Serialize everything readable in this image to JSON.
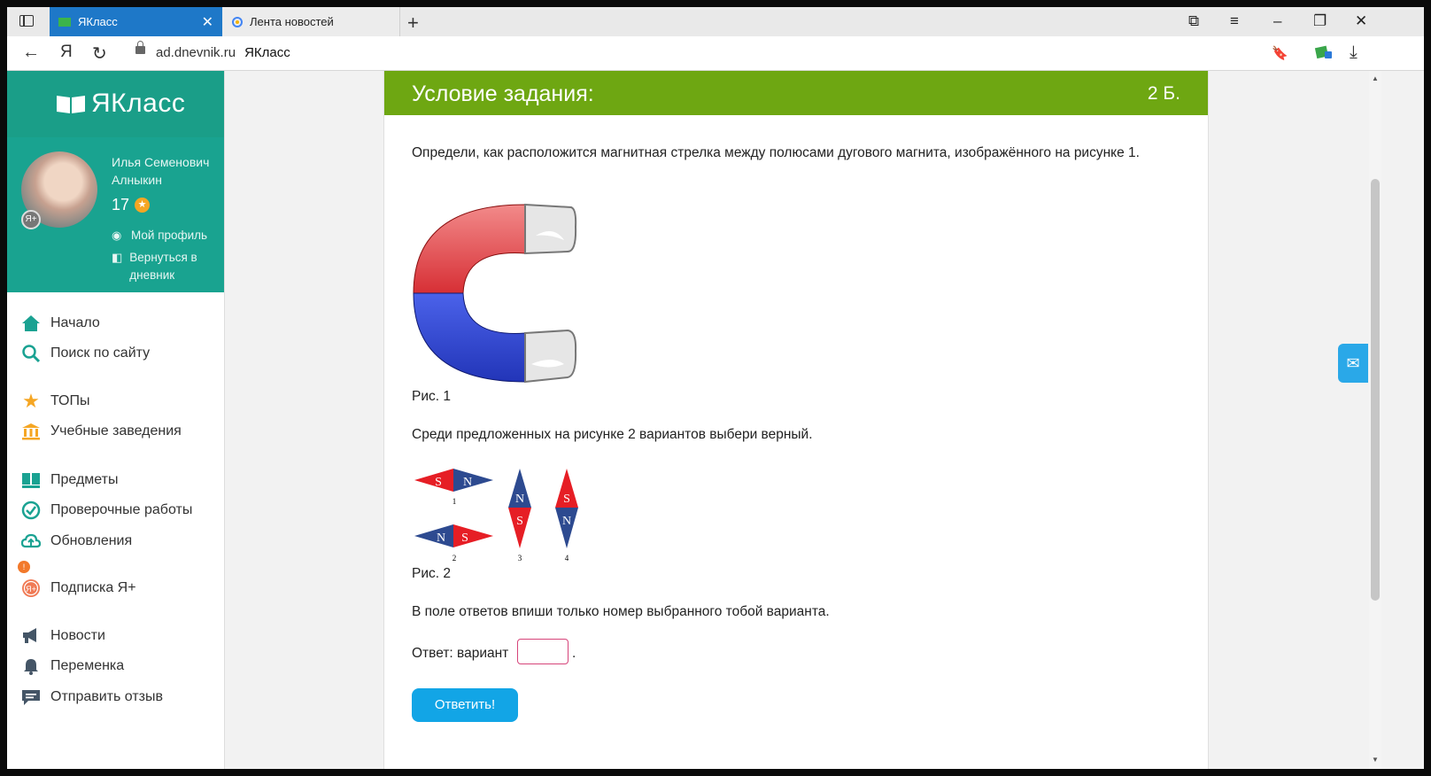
{
  "browser": {
    "tabs": [
      {
        "label": "ЯКласс",
        "active": true
      },
      {
        "label": "Лента новостей",
        "active": false
      }
    ],
    "url_host": "ad.dnevnik.ru",
    "url_title": "ЯКласс"
  },
  "sidebar": {
    "logo": "ЯКласс",
    "profile": {
      "name": "Илья Семенович Алныкин",
      "score": "17",
      "links": [
        {
          "label": "Мой профиль"
        },
        {
          "label": "Вернуться в дневник"
        }
      ]
    },
    "menu": [
      {
        "label": "Начало"
      },
      {
        "label": "Поиск по сайту"
      },
      {
        "label": "ТОПы"
      },
      {
        "label": "Учебные заведения"
      },
      {
        "label": "Предметы"
      },
      {
        "label": "Проверочные работы",
        "badge": "!"
      },
      {
        "label": "Обновления"
      },
      {
        "label": "Подписка Я+"
      },
      {
        "label": "Новости"
      },
      {
        "label": "Переменка"
      },
      {
        "label": "Отправить отзыв"
      }
    ]
  },
  "task": {
    "title": "Условие задания:",
    "points": "2 Б.",
    "question": "Определи, как расположится магнитная стрелка между полюсами дугового магнита, изображённого на рисунке 1.",
    "fig1_caption": "Рис. 1",
    "instruction": "Среди предложенных на рисунке 2 вариантов выбери верный.",
    "fig2_caption": "Рис. 2",
    "fig2_options": [
      {
        "number": "1",
        "poles": [
          "S",
          "N"
        ]
      },
      {
        "number": "2",
        "poles": [
          "N",
          "S"
        ]
      },
      {
        "number": "3",
        "poles": [
          "N",
          "S"
        ]
      },
      {
        "number": "4",
        "poles": [
          "S",
          "N"
        ]
      }
    ],
    "answer_hint": "В поле ответов впиши только номер выбранного тобой варианта.",
    "answer_label": "Ответ: вариант",
    "answer_value": "",
    "answer_suffix": ".",
    "submit_label": "Ответить!"
  },
  "colors": {
    "brand_green": "#19a390",
    "header_green": "#6ea712",
    "button_blue": "#12a5e6",
    "tab_blue": "#1e78c8",
    "magnet_red": "#e8373c",
    "magnet_blue": "#2c47c8"
  }
}
